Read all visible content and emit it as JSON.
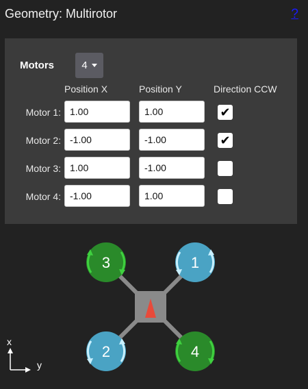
{
  "header": {
    "title": "Geometry: Multirotor",
    "help_label": "?"
  },
  "motors": {
    "label": "Motors",
    "count": "4"
  },
  "columns": {
    "x": "Position X",
    "y": "Position Y",
    "dir": "Direction CCW"
  },
  "rows": [
    {
      "label": "Motor 1:",
      "x": "1.00",
      "y": "1.00",
      "ccw": true,
      "ccw_mark": "✔"
    },
    {
      "label": "Motor 2:",
      "x": "-1.00",
      "y": "-1.00",
      "ccw": true,
      "ccw_mark": "✔"
    },
    {
      "label": "Motor 3:",
      "x": "1.00",
      "y": "-1.00",
      "ccw": false,
      "ccw_mark": ""
    },
    {
      "label": "Motor 4:",
      "x": "-1.00",
      "y": "1.00",
      "ccw": false,
      "ccw_mark": ""
    }
  ],
  "diagram": {
    "props": [
      {
        "num": "1",
        "color": "#4aa3c4"
      },
      {
        "num": "2",
        "color": "#4aa3c4"
      },
      {
        "num": "3",
        "color": "#2a8a2a"
      },
      {
        "num": "4",
        "color": "#2a8a2a"
      }
    ],
    "axis_x": "x",
    "axis_y": "y"
  }
}
